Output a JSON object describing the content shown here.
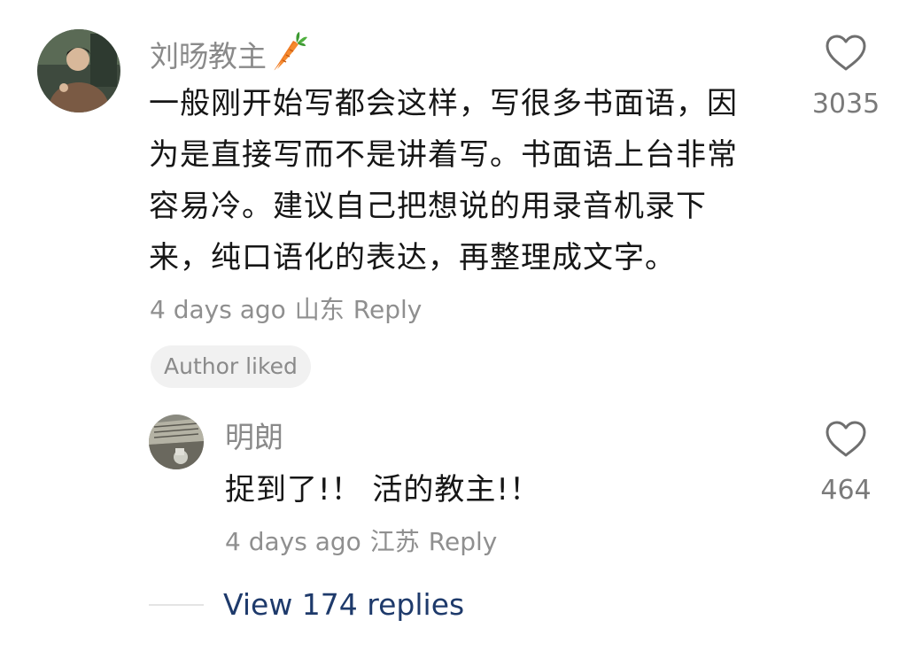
{
  "comment": {
    "username": "刘旸教主",
    "username_emoji": "carrot-icon",
    "text_lines": [
      "一般刚开始写都会这样，写很多书面语，因",
      "为是直接写而不是讲着写。书面语上台非常",
      "容易冷。建议自己把想说的用录音机录下",
      "来，纯口语化的表达，再整理成文字。"
    ],
    "time": "4 days ago",
    "location": "山东",
    "reply_label": "Reply",
    "like_count": "3035",
    "author_liked_label": "Author liked"
  },
  "reply": {
    "username": "明朗",
    "text": "捉到了!！ 活的教主!！",
    "time": "4 days ago",
    "location": "江苏",
    "reply_label": "Reply",
    "like_count": "464"
  },
  "view_replies_label": "View 174 replies",
  "colors": {
    "username": "#8a8a8a",
    "meta": "#8f8f8f",
    "view_replies": "#1e3a6b",
    "badge_bg": "#f1f1f1"
  }
}
